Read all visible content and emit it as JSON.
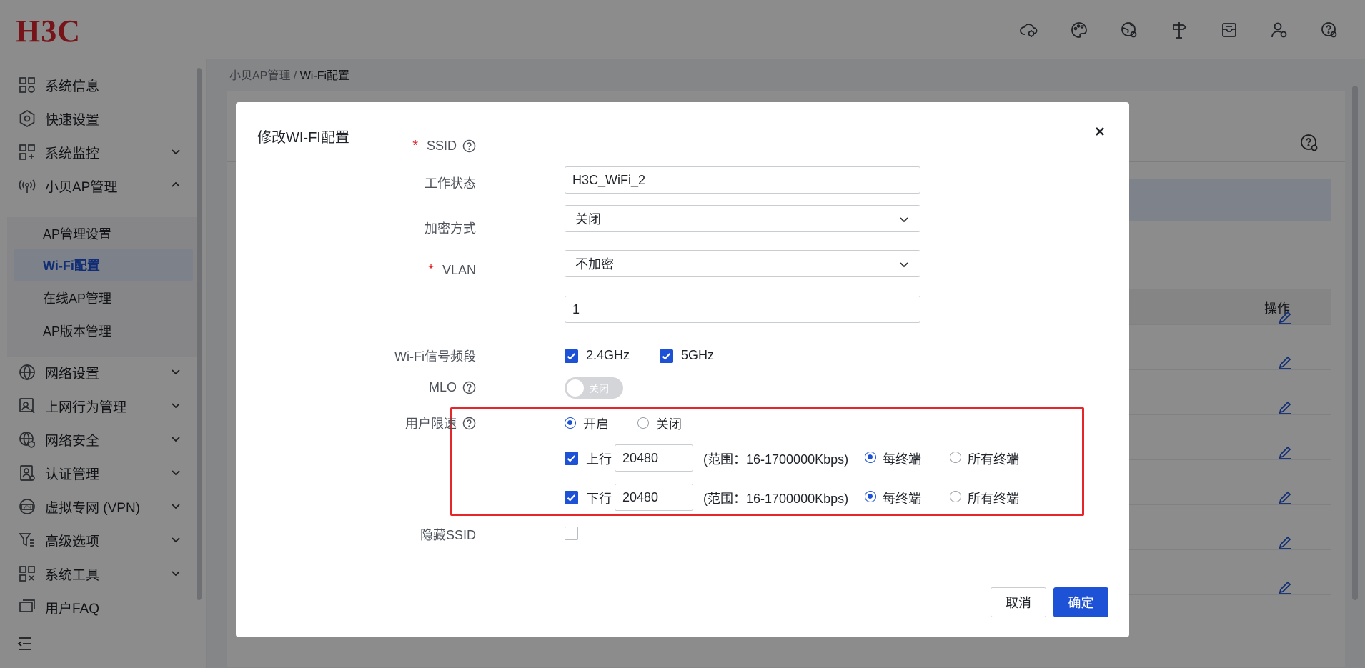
{
  "header": {
    "logo": "H3C",
    "icons": [
      "cloud-settings-icon",
      "palette-icon",
      "globe-settings-icon",
      "signpost-icon",
      "inbox-icon",
      "user-settings-icon",
      "help-settings-icon"
    ]
  },
  "sidebar": {
    "items": [
      {
        "label": "系统信息",
        "icon": "dashboard-icon",
        "expandable": false
      },
      {
        "label": "快速设置",
        "icon": "hexagon-settings-icon",
        "expandable": false
      },
      {
        "label": "系统监控",
        "icon": "monitor-grid-icon",
        "expandable": true
      },
      {
        "label": "小贝AP管理",
        "icon": "wireless-ap-icon",
        "expandable": true,
        "expanded": true
      },
      {
        "label": "网络设置",
        "icon": "globe-icon",
        "expandable": true
      },
      {
        "label": "上网行为管理",
        "icon": "behavior-icon",
        "expandable": true
      },
      {
        "label": "网络安全",
        "icon": "security-globe-icon",
        "expandable": true
      },
      {
        "label": "认证管理",
        "icon": "auth-icon",
        "expandable": true
      },
      {
        "label": "虚拟专网 (VPN)",
        "icon": "vpn-icon",
        "expandable": true
      },
      {
        "label": "高级选项",
        "icon": "filter-icon",
        "expandable": true
      },
      {
        "label": "系统工具",
        "icon": "tools-icon",
        "expandable": true
      },
      {
        "label": "用户FAQ",
        "icon": "faq-icon",
        "expandable": false
      }
    ],
    "sub_items": [
      {
        "label": "AP管理设置"
      },
      {
        "label": "Wi-Fi配置",
        "active": true
      },
      {
        "label": "在线AP管理"
      },
      {
        "label": "AP版本管理"
      }
    ]
  },
  "breadcrumb": {
    "parent": "小贝AP管理",
    "separator": " / ",
    "current": "Wi-Fi配置"
  },
  "table": {
    "op_header": "操作"
  },
  "modal": {
    "title": "修改WI-FI配置",
    "fields": {
      "ssid": {
        "label": "SSID",
        "value": "H3C_WiFi_2"
      },
      "work_state": {
        "label": "工作状态",
        "value": "关闭"
      },
      "encryption": {
        "label": "加密方式",
        "value": "不加密"
      },
      "vlan": {
        "label": "VLAN",
        "value": "1"
      },
      "band": {
        "label": "Wi-Fi信号频段",
        "opt_24": "2.4GHz",
        "opt_5": "5GHz",
        "checked_24": true,
        "checked_5": true
      },
      "mlo": {
        "label": "MLO",
        "state_text": "关闭",
        "on": false
      },
      "rate_limit": {
        "label": "用户限速",
        "on_label": "开启",
        "off_label": "关闭",
        "selected": "开启",
        "up": {
          "label": "上行",
          "checked": true,
          "value": "20480",
          "range": "(范围：16-1700000Kbps)",
          "per_terminal": "每终端",
          "all_terminal": "所有终端",
          "selected": "每终端"
        },
        "down": {
          "label": "下行",
          "checked": true,
          "value": "20480",
          "range": "(范围：16-1700000Kbps)",
          "per_terminal": "每终端",
          "all_terminal": "所有终端",
          "selected": "每终端"
        }
      },
      "hide_ssid": {
        "label": "隐藏SSID",
        "checked": false
      }
    },
    "buttons": {
      "cancel": "取消",
      "ok": "确定"
    }
  },
  "colors": {
    "brand": "#d7262e",
    "accent": "#1e52d6",
    "highlight": "#e5262a"
  }
}
